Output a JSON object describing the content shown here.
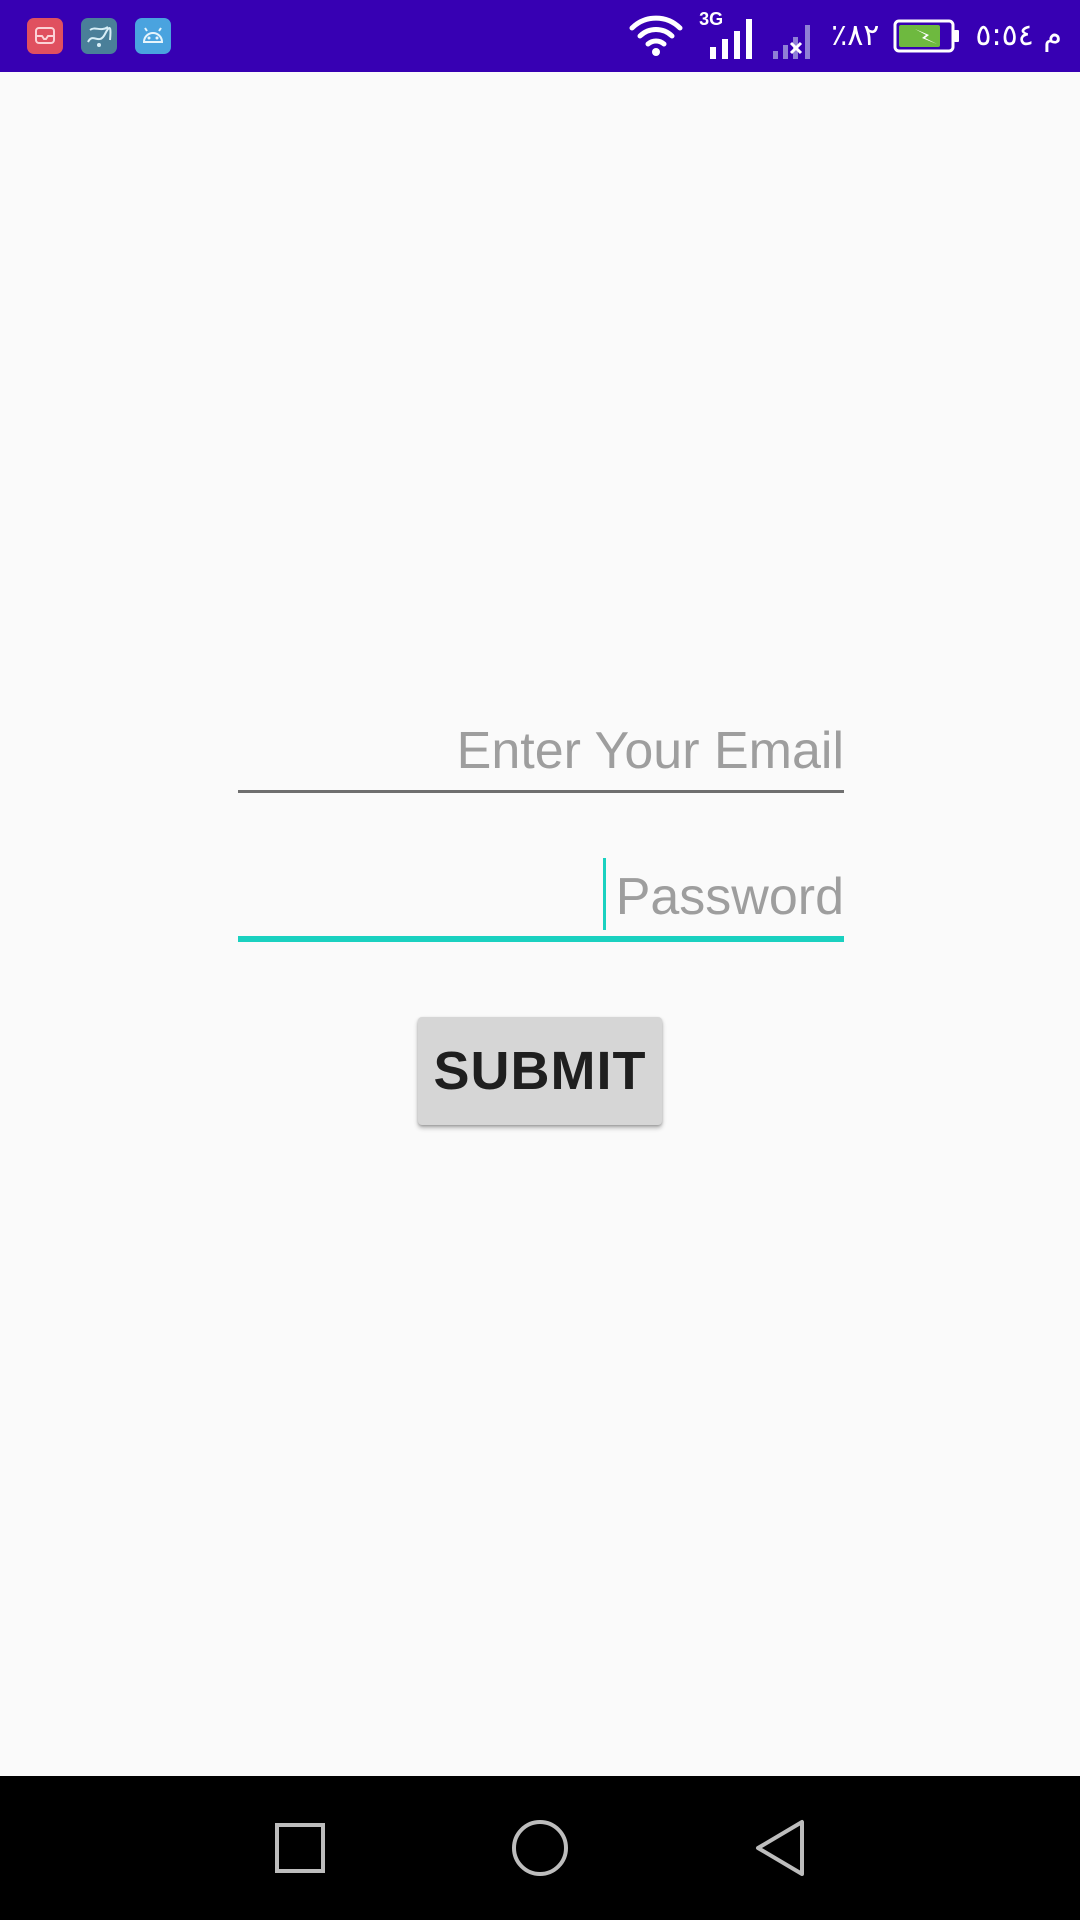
{
  "status_bar": {
    "background_color": "#3700b3",
    "notification_icons": [
      {
        "name": "message-app-icon",
        "color": "#e0505f"
      },
      {
        "name": "calligraphy-app-icon",
        "color": "#4a7f99"
      },
      {
        "name": "android-studio-icon",
        "color": "#4aa3df"
      }
    ],
    "network_type": "3G",
    "battery_percent": "٪٨٢",
    "battery_level": 0.82,
    "time": "م ٥:٥٤"
  },
  "form": {
    "email_placeholder": "Enter Your Email",
    "email_value": "",
    "password_placeholder": "Password",
    "password_value": "",
    "submit_label": "SUBMIT",
    "accent_color": "#1ad1c0"
  },
  "nav_bar": {
    "icons": [
      "recents-icon",
      "home-icon",
      "back-icon"
    ]
  }
}
